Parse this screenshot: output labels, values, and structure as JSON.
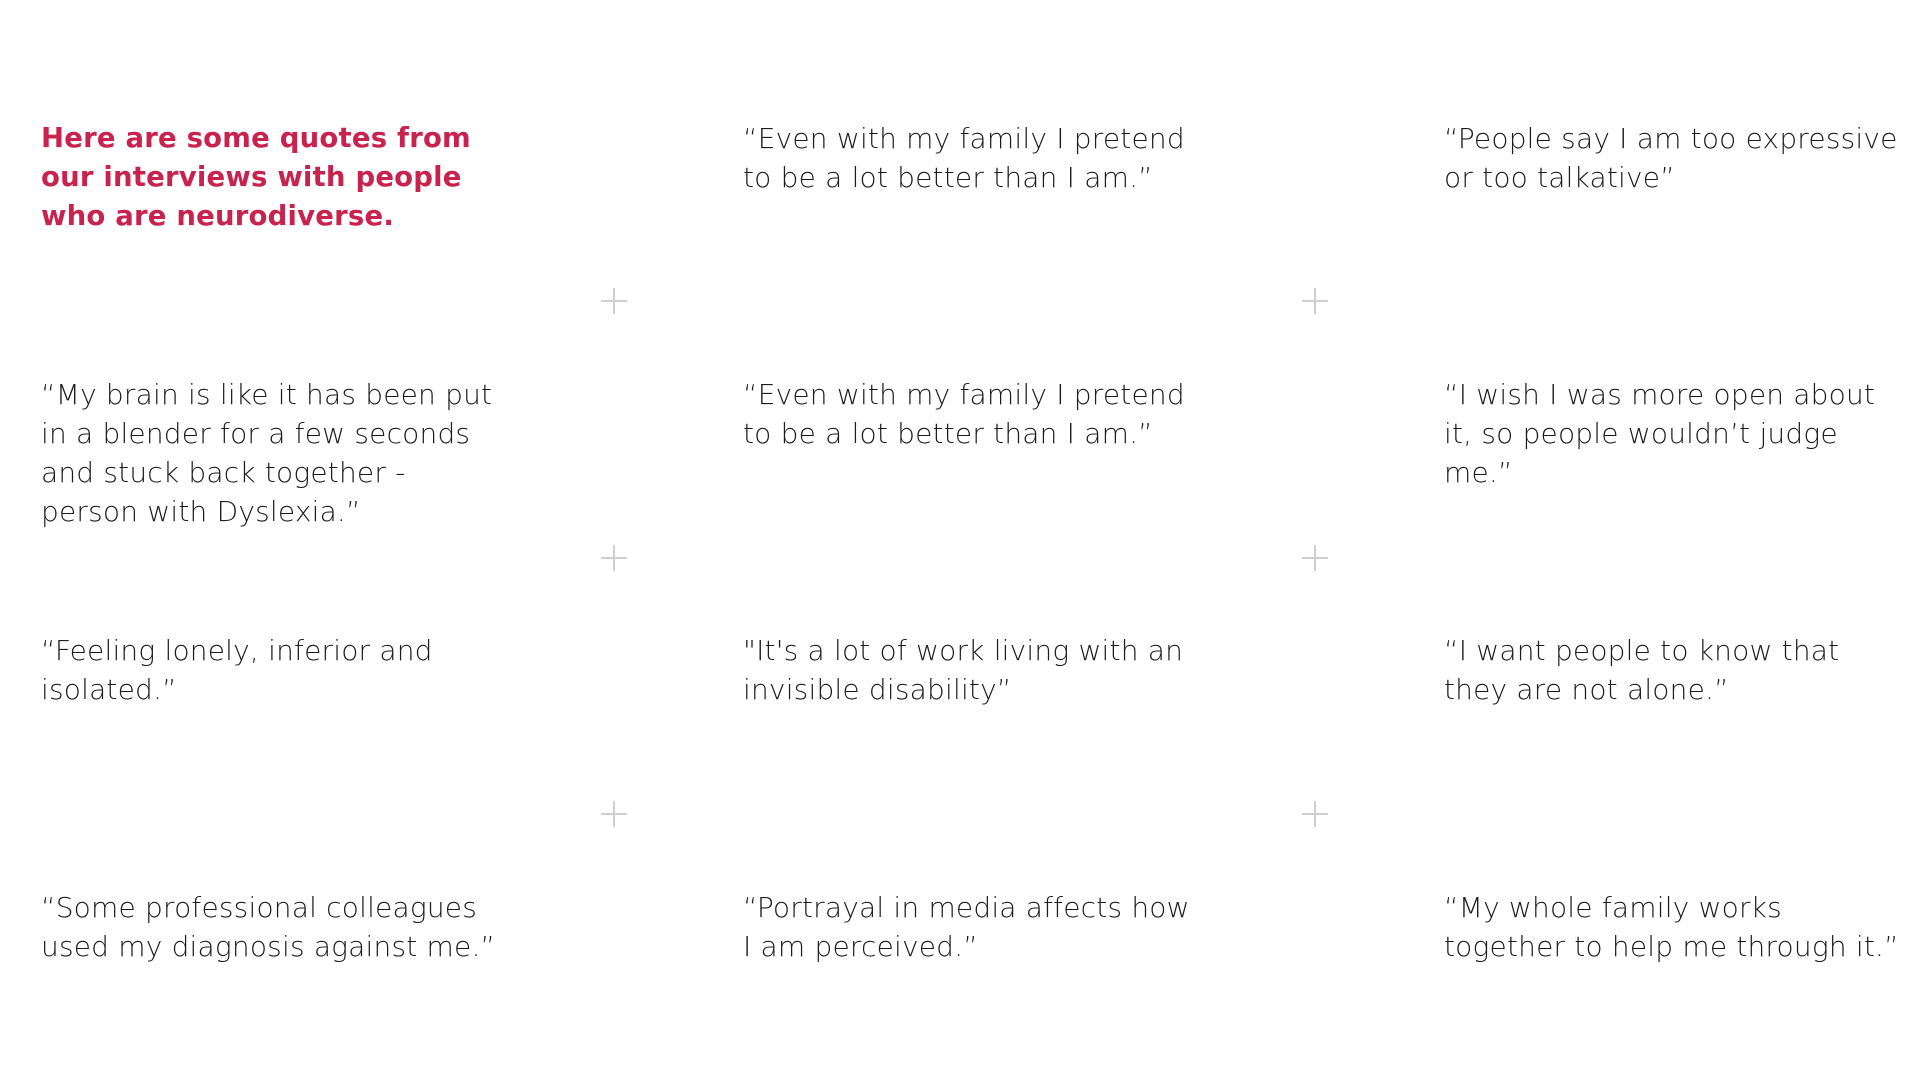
{
  "intro": "Here are some quotes from our interviews with people who are neurodiverse.",
  "quotes": [
    "“Even with my family I pretend to be a lot better than I am.”",
    "“People say I am too expressive or too talkative”",
    "“My brain is like it has been put in a blender for a few seconds and stuck back together - person with Dyslexia.”",
    "“Even with my family I pretend to be a lot better than I am.”",
    "“I wish I was more open about it, so people wouldn’t judge me.”",
    "“Feeling lonely, inferior and isolated.”",
    "\"It's a lot of work living with an invisible disability”",
    "“I want people to know that they are not alone.”",
    "“Some professional colleagues used my diagnosis against me.”",
    "“Portrayal in media affects how I am perceived.”",
    "“My whole family works together to help me through it.”"
  ],
  "colors": {
    "accent": "#c8234f",
    "text": "#1c1c1c",
    "divider": "#cfcfcf"
  }
}
